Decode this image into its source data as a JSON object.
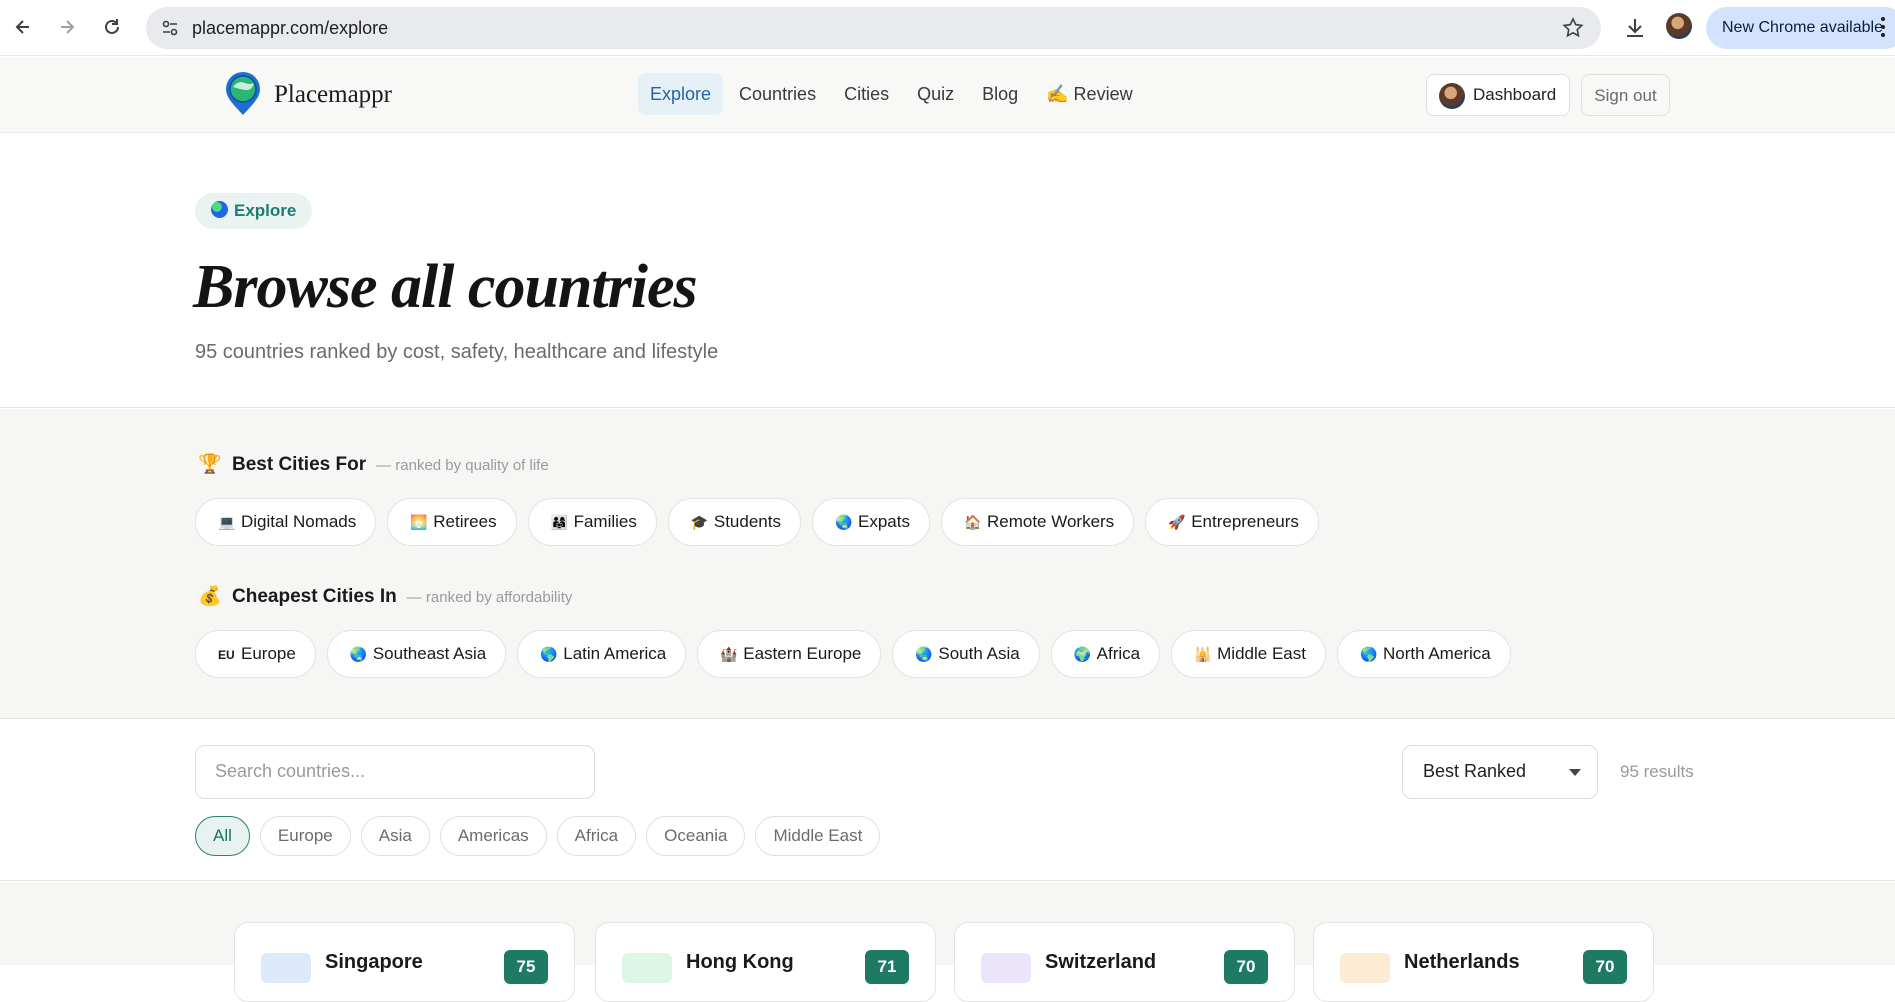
{
  "browser": {
    "url": "placemappr.com/explore",
    "update_label": "New Chrome available"
  },
  "header": {
    "brand": "Placemappr",
    "nav": [
      {
        "label": "Explore",
        "active": true
      },
      {
        "label": "Countries"
      },
      {
        "label": "Cities"
      },
      {
        "label": "Quiz"
      },
      {
        "label": "Blog"
      },
      {
        "label": "✍️ Review"
      }
    ],
    "dashboard_label": "Dashboard",
    "signout_label": "Sign out"
  },
  "hero": {
    "chip": "Explore",
    "title": "Browse all countries",
    "subtitle": "95 countries ranked by cost, safety, healthcare and lifestyle"
  },
  "best_cities": {
    "icon": "🏆",
    "title": "Best Cities For",
    "subtitle": "— ranked by quality of life",
    "chips": [
      {
        "emoji": "💻",
        "label": "Digital Nomads"
      },
      {
        "emoji": "🌅",
        "label": "Retirees"
      },
      {
        "emoji": "👨‍👩‍👧",
        "label": "Families"
      },
      {
        "emoji": "🎓",
        "label": "Students"
      },
      {
        "emoji": "🌏",
        "label": "Expats"
      },
      {
        "emoji": "🏠",
        "label": "Remote Workers"
      },
      {
        "emoji": "🚀",
        "label": "Entrepreneurs"
      }
    ]
  },
  "cheapest_cities": {
    "icon": "💰",
    "title": "Cheapest Cities In",
    "subtitle": "— ranked by affordability",
    "chips": [
      {
        "emoji": "EU",
        "label": "Europe"
      },
      {
        "emoji": "🌏",
        "label": "Southeast Asia"
      },
      {
        "emoji": "🌎",
        "label": "Latin America"
      },
      {
        "emoji": "🏰",
        "label": "Eastern Europe"
      },
      {
        "emoji": "🌏",
        "label": "South Asia"
      },
      {
        "emoji": "🌍",
        "label": "Africa"
      },
      {
        "emoji": "🕌",
        "label": "Middle East"
      },
      {
        "emoji": "🌎",
        "label": "North America"
      }
    ]
  },
  "filters": {
    "search_placeholder": "Search countries...",
    "sort_value": "Best Ranked",
    "results": "95 results",
    "regions": [
      {
        "label": "All",
        "active": true
      },
      {
        "label": "Europe"
      },
      {
        "label": "Asia"
      },
      {
        "label": "Americas"
      },
      {
        "label": "Africa"
      },
      {
        "label": "Oceania"
      },
      {
        "label": "Middle East"
      }
    ]
  },
  "cards": [
    {
      "name": "Singapore",
      "score": "75",
      "tint": "#dbe9fb"
    },
    {
      "name": "Hong Kong",
      "score": "71",
      "tint": "#dcf7e6"
    },
    {
      "name": "Switzerland",
      "score": "70",
      "tint": "#ece4fb"
    },
    {
      "name": "Netherlands",
      "score": "70",
      "tint": "#fdebd3"
    }
  ],
  "colors": {
    "accent": "#2563a8",
    "teal": "#1e7b6e",
    "score": "#1f7a64"
  }
}
